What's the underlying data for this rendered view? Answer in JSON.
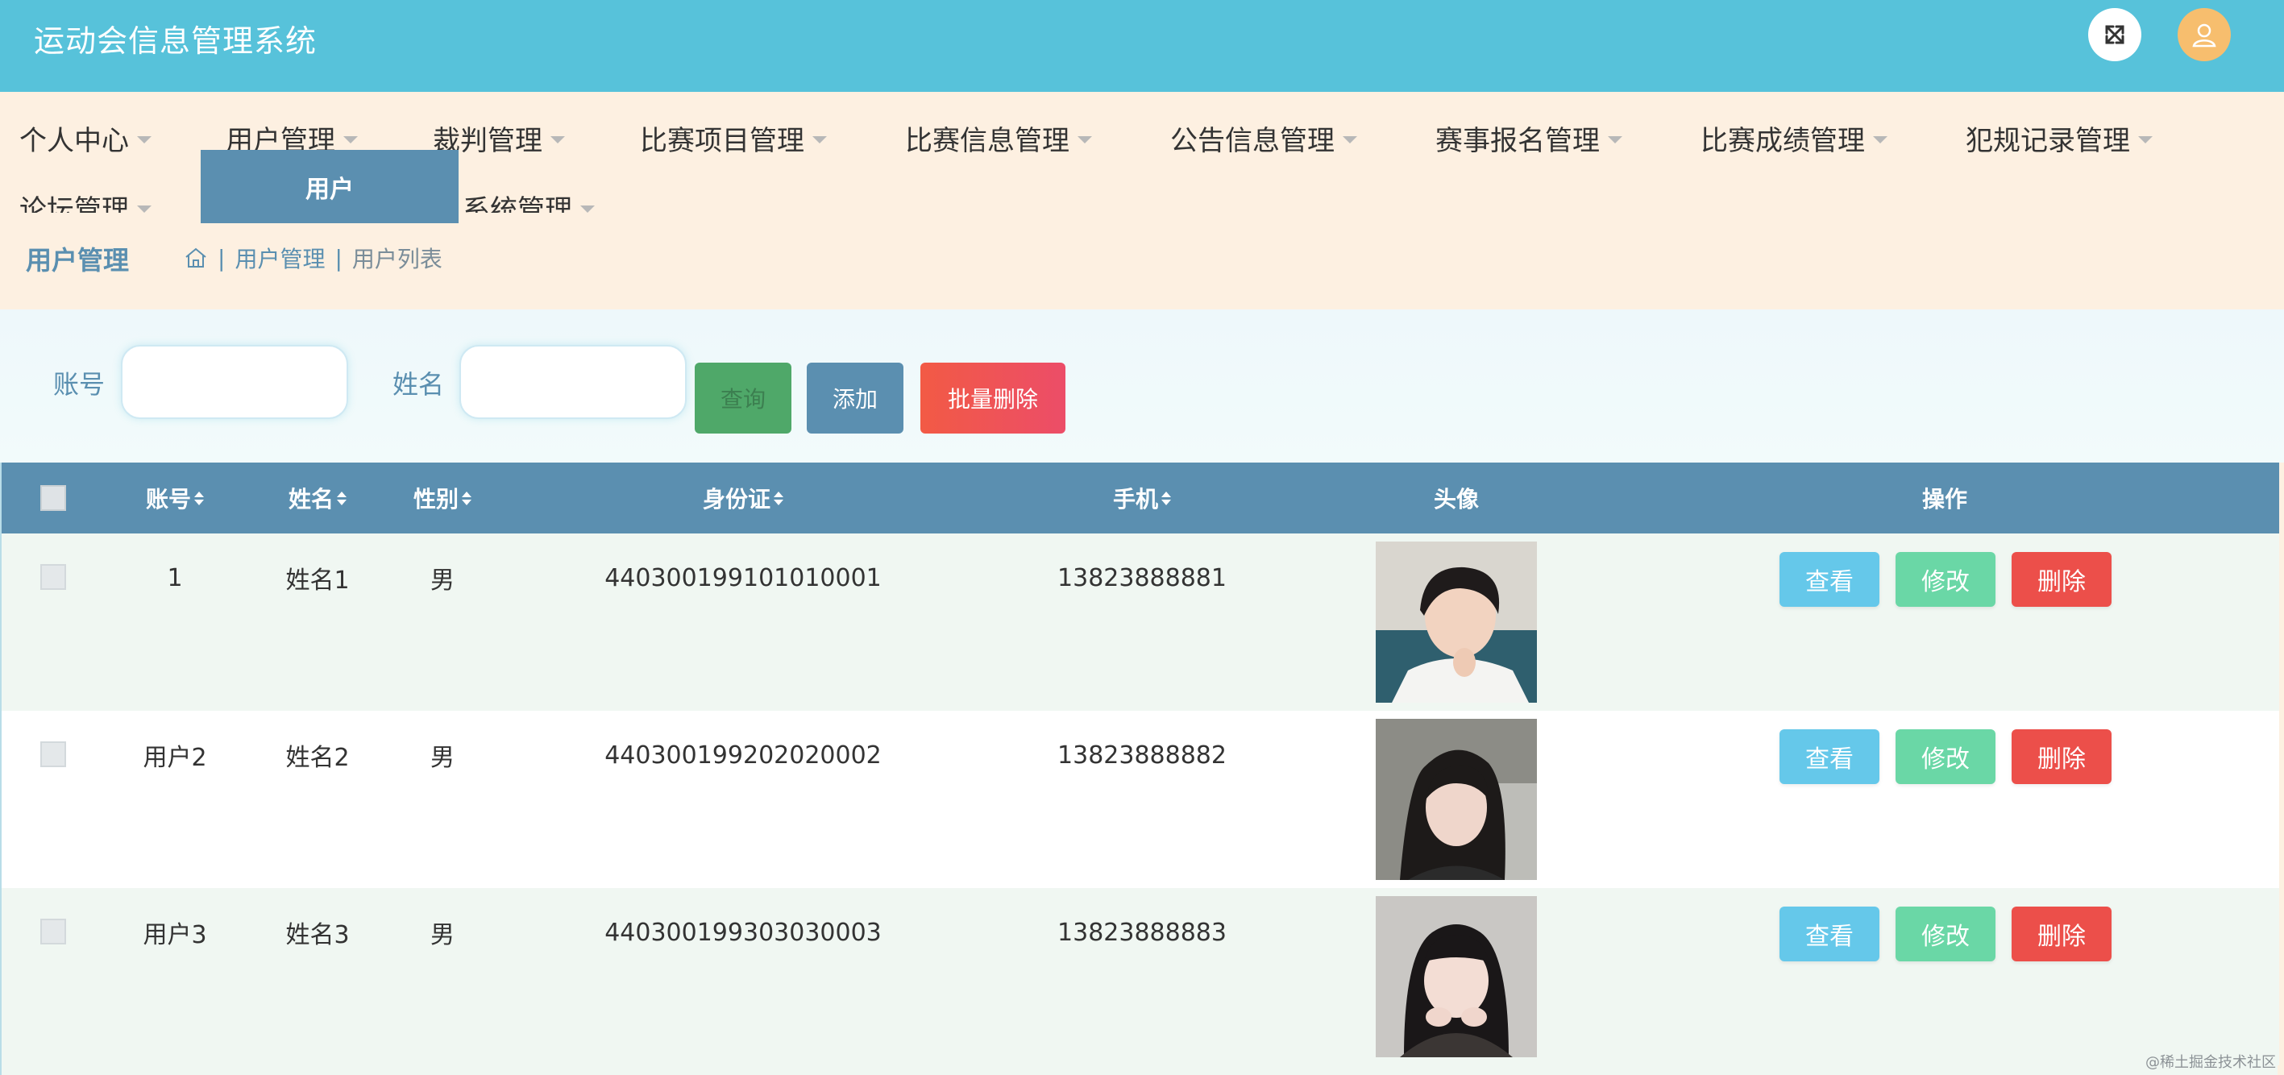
{
  "header": {
    "title": "运动会信息管理系统",
    "fullscreen_icon": "fullscreen-icon",
    "user_icon": "user-icon",
    "colors": {
      "bar": "#57c2da",
      "avatar": "#f7be6e"
    }
  },
  "menu": {
    "items": [
      "个人中心",
      "用户管理",
      "裁判管理",
      "比赛项目管理",
      "比赛信息管理",
      "公告信息管理",
      "赛事报名管理",
      "比赛成绩管理",
      "犯规记录管理",
      "论坛管理",
      "系统管理"
    ],
    "dropdown_open_label": "用户"
  },
  "breadcrumb": {
    "title": "用户管理",
    "home_icon": "home-icon",
    "items": [
      "用户管理",
      "用户列表"
    ]
  },
  "search": {
    "account_label": "账号",
    "account_value": "",
    "name_label": "姓名",
    "name_value": "",
    "query_button": "查询",
    "add_button": "添加",
    "batch_delete_button": "批量删除"
  },
  "table": {
    "columns": [
      "账号",
      "姓名",
      "性别",
      "身份证",
      "手机",
      "头像",
      "操作"
    ],
    "rows": [
      {
        "account": "1",
        "name": "姓名1",
        "gender": "男",
        "id_card": "440300199101010001",
        "phone": "13823888881"
      },
      {
        "account": "用户2",
        "name": "姓名2",
        "gender": "男",
        "id_card": "440300199202020002",
        "phone": "13823888882"
      },
      {
        "account": "用户3",
        "name": "姓名3",
        "gender": "男",
        "id_card": "440300199303030003",
        "phone": "13823888883"
      }
    ],
    "actions": {
      "view": "查看",
      "edit": "修改",
      "delete": "删除"
    }
  },
  "watermark": "@稀土掘金技术社区"
}
